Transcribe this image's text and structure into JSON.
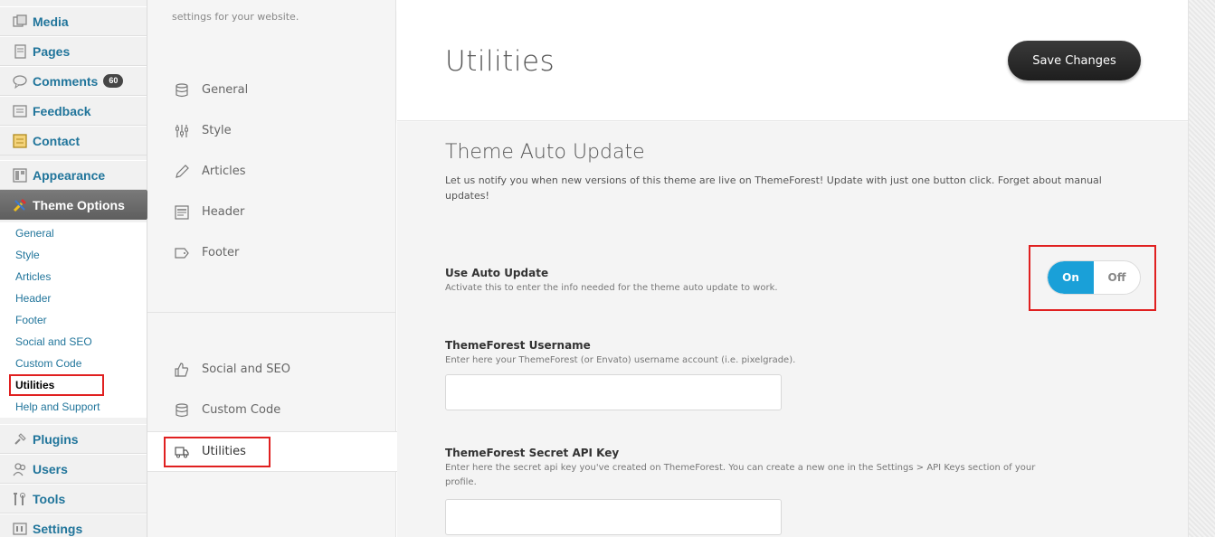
{
  "wp_menu": {
    "items_top": [
      {
        "label": "Media",
        "icon": "media-icon"
      },
      {
        "label": "Pages",
        "icon": "pages-icon"
      },
      {
        "label": "Comments",
        "icon": "comments-icon",
        "badge": "60"
      },
      {
        "label": "Feedback",
        "icon": "feedback-icon"
      },
      {
        "label": "Contact",
        "icon": "contact-icon"
      },
      {
        "label": "Appearance",
        "icon": "appearance-icon"
      }
    ],
    "active": {
      "label": "Theme Options",
      "icon": "theme-options-icon"
    },
    "submenu": [
      "General",
      "Style",
      "Articles",
      "Header",
      "Footer",
      "Social and SEO",
      "Custom Code",
      "Utilities",
      "Help and Support"
    ],
    "current_sub": "Utilities",
    "items_bottom": [
      {
        "label": "Plugins",
        "icon": "plugins-icon"
      },
      {
        "label": "Users",
        "icon": "users-icon"
      },
      {
        "label": "Tools",
        "icon": "tools-icon"
      },
      {
        "label": "Settings",
        "icon": "settings-icon"
      }
    ]
  },
  "options_nav": {
    "intro": "settings for your website.",
    "items": [
      {
        "label": "General",
        "icon": "database-icon"
      },
      {
        "label": "Style",
        "icon": "sliders-icon"
      },
      {
        "label": "Articles",
        "icon": "pencil-icon"
      },
      {
        "label": "Header",
        "icon": "header-icon"
      },
      {
        "label": "Footer",
        "icon": "tag-icon"
      },
      {
        "label": "Social and SEO",
        "icon": "thumbs-up-icon"
      },
      {
        "label": "Custom Code",
        "icon": "database-icon"
      },
      {
        "label": "Utilities",
        "icon": "truck-icon"
      }
    ],
    "active": "Utilities"
  },
  "main": {
    "title": "Utilities",
    "save_label": "Save Changes",
    "section": {
      "title": "Theme Auto Update",
      "description": "Let us notify you when new versions of this theme are live on ThemeForest! Update with just one button click. Forget about manual updates!"
    },
    "auto_update": {
      "title": "Use Auto Update",
      "description": "Activate this to enter the info needed for the theme auto update to work.",
      "on_label": "On",
      "off_label": "Off",
      "value": "On"
    },
    "username": {
      "title": "ThemeForest Username",
      "description": "Enter here your ThemeForest (or Envato) username account (i.e. pixelgrade).",
      "value": ""
    },
    "api_key": {
      "title": "ThemeForest Secret API Key",
      "description": "Enter here the secret api key you've created on ThemeForest. You can create a new one in the Settings > API Keys section of your profile.",
      "value": ""
    }
  },
  "colors": {
    "link": "#21759b",
    "toggle_on": "#1aa0d8",
    "highlight": "#e02020",
    "save_button": "#2a2a2a"
  }
}
